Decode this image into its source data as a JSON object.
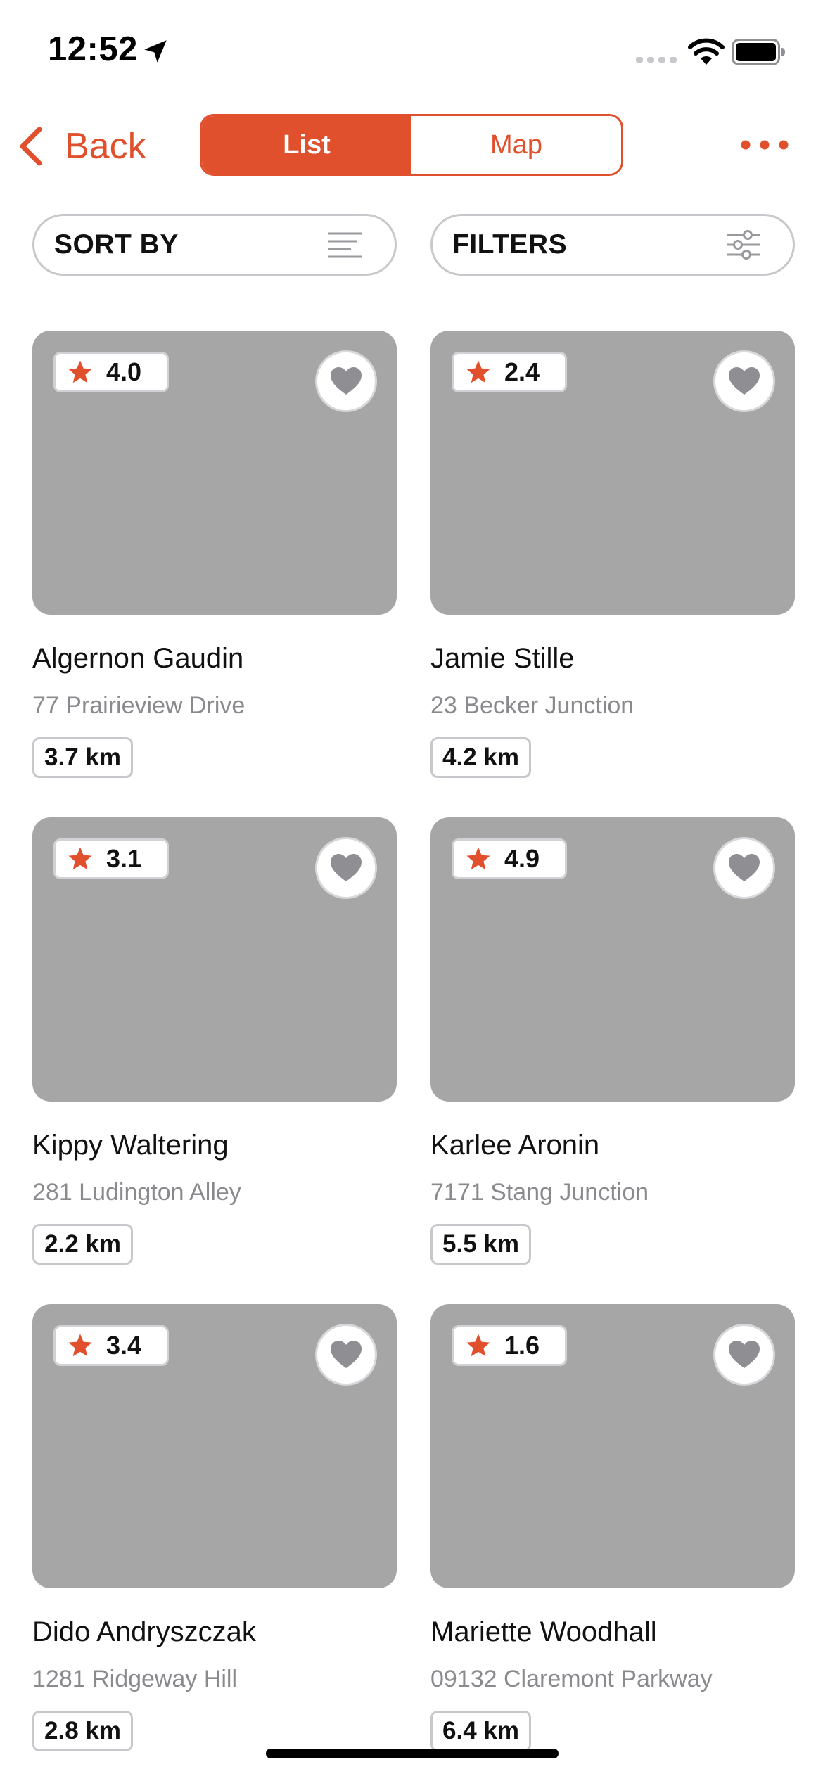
{
  "status_bar": {
    "time": "12:52"
  },
  "nav": {
    "back_label": "Back",
    "segments": [
      {
        "label": "List",
        "active": true
      },
      {
        "label": "Map",
        "active": false
      }
    ]
  },
  "controls": {
    "sort_label": "SORT BY",
    "filter_label": "FILTERS"
  },
  "colors": {
    "accent": "#e0502d",
    "image_placeholder": "#a6a6a6",
    "secondary_text": "#8a8a8e"
  },
  "listings": [
    {
      "rating": "4.0",
      "name": "Algernon Gaudin",
      "address": "77 Prairieview Drive",
      "distance": "3.7 km"
    },
    {
      "rating": "2.4",
      "name": "Jamie Stille",
      "address": "23 Becker Junction",
      "distance": "4.2 km"
    },
    {
      "rating": "3.1",
      "name": "Kippy Waltering",
      "address": "281 Ludington Alley",
      "distance": "2.2 km"
    },
    {
      "rating": "4.9",
      "name": "Karlee Aronin",
      "address": "7171 Stang Junction",
      "distance": "5.5 km"
    },
    {
      "rating": "3.4",
      "name": "Dido Andryszczak",
      "address": "1281 Ridgeway Hill",
      "distance": "2.8 km"
    },
    {
      "rating": "1.6",
      "name": "Mariette Woodhall",
      "address": "09132 Claremont Parkway",
      "distance": "6.4 km"
    }
  ]
}
